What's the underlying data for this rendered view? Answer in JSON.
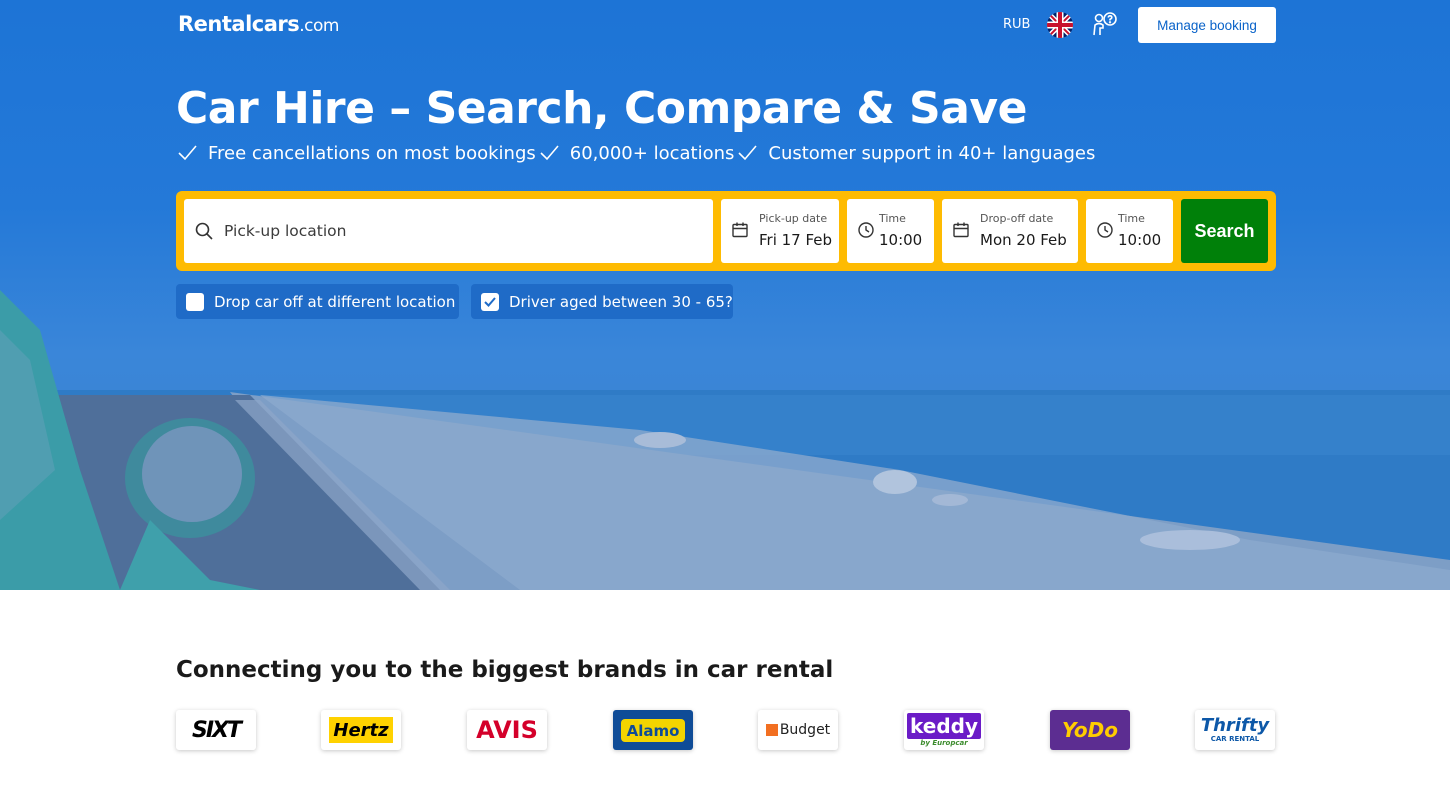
{
  "header": {
    "logo_main": "Rentalcars",
    "logo_suffix": ".com",
    "currency": "RUB",
    "flag_icon": "uk-flag-icon",
    "help_icon": "customer-support-icon",
    "manage_booking": "Manage booking"
  },
  "hero": {
    "title": "Car Hire – Search, Compare & Save",
    "usps": [
      "Free cancellations on most bookings",
      "60,000+ locations",
      "Customer support in 40+ languages"
    ]
  },
  "search": {
    "location_placeholder": "Pick-up location",
    "pickup_date_label": "Pick-up date",
    "pickup_date_value": "Fri 17 Feb",
    "pickup_time_label": "Time",
    "pickup_time_value": "10:00",
    "dropoff_date_label": "Drop-off date",
    "dropoff_date_value": "Mon 20 Feb",
    "dropoff_time_label": "Time",
    "dropoff_time_value": "10:00",
    "button": "Search",
    "different_location_label": "Drop car off at different location",
    "different_location_checked": false,
    "driver_age_label": "Driver aged between 30 - 65?",
    "driver_age_checked": true
  },
  "brands": {
    "title": "Connecting you to the biggest brands in car rental",
    "items": [
      {
        "name": "SIXT",
        "color": "#000000"
      },
      {
        "name": "Hertz",
        "color": "#ffd200"
      },
      {
        "name": "AVIS",
        "color": "#d4002a"
      },
      {
        "name": "Alamo",
        "color": "#0f4c97"
      },
      {
        "name": "Budget",
        "color": "#f26f21"
      },
      {
        "name": "keddy",
        "sub": "by Europcar",
        "color": "#6b1cc7"
      },
      {
        "name": "YoDo",
        "color": "#5c2d91"
      },
      {
        "name": "Thrifty",
        "sub": "CAR RENTAL",
        "color": "#0d58a8"
      }
    ]
  },
  "colors": {
    "hero_blue": "#1d74d6",
    "search_frame": "#febb02",
    "search_button": "#008009"
  }
}
